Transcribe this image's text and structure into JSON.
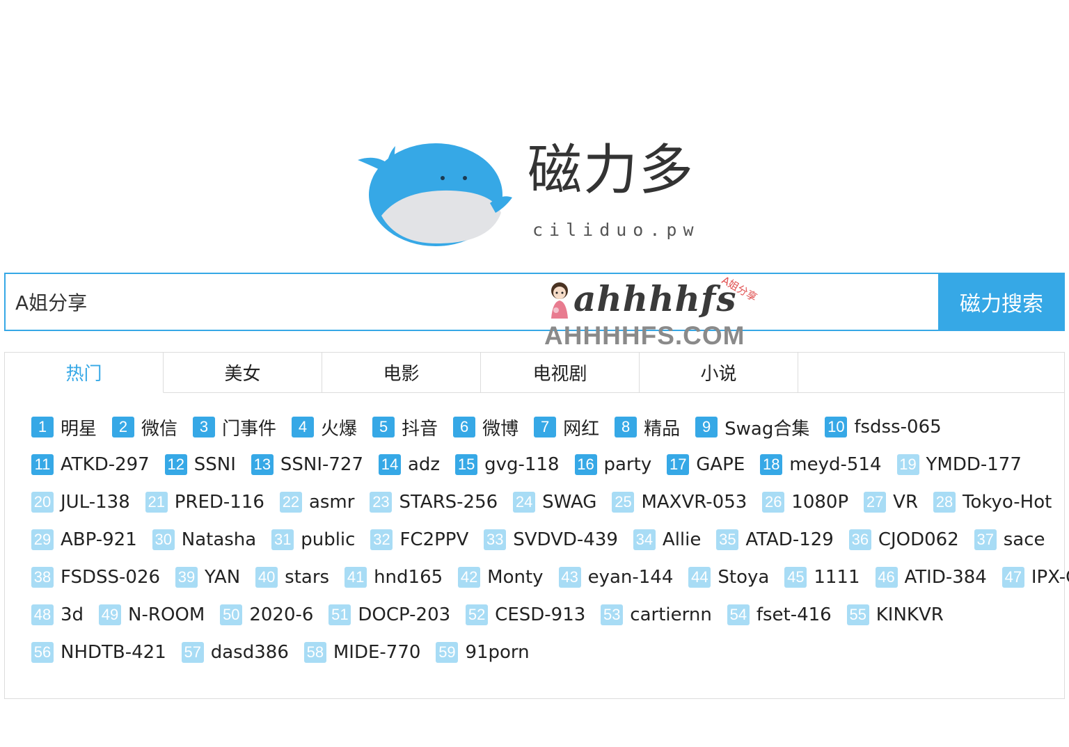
{
  "brand": {
    "name": "磁力多",
    "domain": "ciliduo.pw"
  },
  "search": {
    "query": "A姐分享",
    "button_label": "磁力搜索"
  },
  "watermark": {
    "script": "ahhhhfs",
    "small": "A姐分享",
    "url": "AHHHHFS.COM"
  },
  "colors": {
    "accent": "#36a8e6",
    "badge_hot": "#36a8e6",
    "badge_cold": "#a8dcf5"
  },
  "tabs": [
    "热门",
    "美女",
    "电影",
    "电视剧",
    "小说"
  ],
  "active_tab": "热门",
  "tag_rows": [
    [
      {
        "n": "1",
        "t": "明星",
        "hot": true
      },
      {
        "n": "2",
        "t": "微信",
        "hot": true
      },
      {
        "n": "3",
        "t": "门事件",
        "hot": true
      },
      {
        "n": "4",
        "t": "火爆",
        "hot": true
      },
      {
        "n": "5",
        "t": "抖音",
        "hot": true
      },
      {
        "n": "6",
        "t": "微博",
        "hot": true
      },
      {
        "n": "7",
        "t": "网红",
        "hot": true
      },
      {
        "n": "8",
        "t": "精品",
        "hot": true
      },
      {
        "n": "9",
        "t": "Swag合集",
        "hot": true
      },
      {
        "n": "10",
        "t": "fsdss-065",
        "hot": true
      }
    ],
    [
      {
        "n": "11",
        "t": "ATKD-297",
        "hot": true
      },
      {
        "n": "12",
        "t": "SSNI",
        "hot": true
      },
      {
        "n": "13",
        "t": "SSNI-727",
        "hot": true
      },
      {
        "n": "14",
        "t": "adz",
        "hot": true
      },
      {
        "n": "15",
        "t": "gvg-118",
        "hot": true
      },
      {
        "n": "16",
        "t": "party",
        "hot": true
      },
      {
        "n": "17",
        "t": "GAPE",
        "hot": true
      },
      {
        "n": "18",
        "t": "meyd-514",
        "hot": true
      },
      {
        "n": "19",
        "t": "YMDD-177",
        "hot": false
      }
    ],
    [
      {
        "n": "20",
        "t": "JUL-138",
        "hot": false
      },
      {
        "n": "21",
        "t": "PRED-116",
        "hot": false
      },
      {
        "n": "22",
        "t": "asmr",
        "hot": false
      },
      {
        "n": "23",
        "t": "STARS-256",
        "hot": false
      },
      {
        "n": "24",
        "t": "SWAG",
        "hot": false
      },
      {
        "n": "25",
        "t": "MAXVR-053",
        "hot": false
      },
      {
        "n": "26",
        "t": "1080P",
        "hot": false
      },
      {
        "n": "27",
        "t": "VR",
        "hot": false
      },
      {
        "n": "28",
        "t": "Tokyo-Hot",
        "hot": false
      }
    ],
    [
      {
        "n": "29",
        "t": "ABP-921",
        "hot": false
      },
      {
        "n": "30",
        "t": "Natasha",
        "hot": false
      },
      {
        "n": "31",
        "t": "public",
        "hot": false
      },
      {
        "n": "32",
        "t": "FC2PPV",
        "hot": false
      },
      {
        "n": "33",
        "t": "SVDVD-439",
        "hot": false
      },
      {
        "n": "34",
        "t": "Allie",
        "hot": false
      },
      {
        "n": "35",
        "t": "ATAD-129",
        "hot": false
      },
      {
        "n": "36",
        "t": "CJOD062",
        "hot": false
      },
      {
        "n": "37",
        "t": "sace",
        "hot": false
      }
    ],
    [
      {
        "n": "38",
        "t": "FSDSS-026",
        "hot": false
      },
      {
        "n": "39",
        "t": "YAN",
        "hot": false
      },
      {
        "n": "40",
        "t": "stars",
        "hot": false
      },
      {
        "n": "41",
        "t": "hnd165",
        "hot": false
      },
      {
        "n": "42",
        "t": "Monty",
        "hot": false
      },
      {
        "n": "43",
        "t": "eyan-144",
        "hot": false
      },
      {
        "n": "44",
        "t": "Stoya",
        "hot": false
      },
      {
        "n": "45",
        "t": "1111",
        "hot": false
      },
      {
        "n": "46",
        "t": "ATID-384",
        "hot": false
      },
      {
        "n": "47",
        "t": "IPX-C",
        "hot": false
      }
    ],
    [
      {
        "n": "48",
        "t": "3d",
        "hot": false
      },
      {
        "n": "49",
        "t": "N-ROOM",
        "hot": false
      },
      {
        "n": "50",
        "t": "2020-6",
        "hot": false
      },
      {
        "n": "51",
        "t": "DOCP-203",
        "hot": false
      },
      {
        "n": "52",
        "t": "CESD-913",
        "hot": false
      },
      {
        "n": "53",
        "t": "cartiernn",
        "hot": false
      },
      {
        "n": "54",
        "t": "fset-416",
        "hot": false
      },
      {
        "n": "55",
        "t": "KINKVR",
        "hot": false
      }
    ],
    [
      {
        "n": "56",
        "t": "NHDTB-421",
        "hot": false
      },
      {
        "n": "57",
        "t": "dasd386",
        "hot": false
      },
      {
        "n": "58",
        "t": "MIDE-770",
        "hot": false
      },
      {
        "n": "59",
        "t": "91porn",
        "hot": false
      }
    ]
  ]
}
